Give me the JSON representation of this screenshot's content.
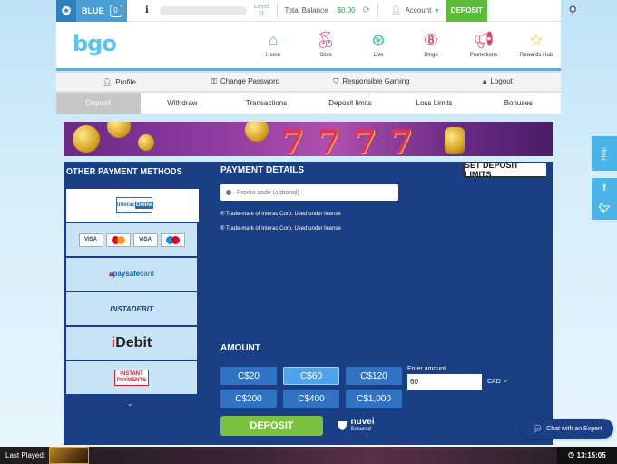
{
  "topbar": {
    "tier_label": "BLUE",
    "tier_count": "0",
    "level_label": "Level",
    "level_value": "0",
    "balance_label": "Total Balance",
    "balance_value": "$0.00",
    "account_label": "Account",
    "deposit_label": "DEPOSIT"
  },
  "header": {
    "logo": "bgo",
    "nav": [
      {
        "label": "Home",
        "icon": "home-icon"
      },
      {
        "label": "Slots",
        "icon": "cherries-icon"
      },
      {
        "label": "Live",
        "icon": "roulette-icon"
      },
      {
        "label": "Bingo",
        "icon": "bingo-ball-icon"
      },
      {
        "label": "Promotions",
        "icon": "megaphone-icon"
      },
      {
        "label": "Rewards Hub",
        "icon": "star-icon"
      }
    ]
  },
  "account_nav": [
    {
      "label": "Profile",
      "icon": "user-icon"
    },
    {
      "label": "Change Password",
      "icon": "key-icon"
    },
    {
      "label": "Responsible Gaming",
      "icon": "shield-icon"
    },
    {
      "label": "Logout",
      "icon": "lock-icon"
    }
  ],
  "tabs": [
    "Deposit",
    "Withdraw",
    "Transactions",
    "Deposit limits",
    "Loss Limits",
    "Bonuses"
  ],
  "deposit": {
    "other_methods_title": "OTHER PAYMENT METHODS",
    "methods": {
      "interac_a": "Interac",
      "interac_b": "Online",
      "visa": "VISA",
      "visa_debit": "VISA",
      "paysafe_a": "paysafe",
      "paysafe_b": "card",
      "instadebit": "INSTADEBIT",
      "idebit_a": "i",
      "idebit_b": "Debit",
      "instant_a": "INSTANT",
      "instant_b": "PAYMENTS"
    },
    "payment_details_title": "PAYMENT DETAILS",
    "set_limits_label": "SET DEPOSIT LIMITS",
    "promo_placeholder": "Promo code (optional)",
    "trademark_1": "® Trade-mark of Interac Corp. Used under license",
    "trademark_2": "® Trade-mark of Interac Corp. Used under license",
    "amount_title": "AMOUNT",
    "amounts": [
      "C$20",
      "C$60",
      "C$120",
      "C$200",
      "C$400",
      "C$1,000"
    ],
    "selected_amount": "C$60",
    "enter_amount_label": "Enter amount",
    "enter_amount_value": "60",
    "currency": "CAD",
    "deposit_button": "DEPOSIT",
    "nuvei_name": "nuvei",
    "nuvei_sub": "Secured"
  },
  "side": {
    "help": "Help",
    "facebook": "f",
    "twitter": "t"
  },
  "chat_label": "Chat with an Expert",
  "bottom": {
    "last_played": "Last Played:",
    "time": "13:15:05"
  },
  "colors": {
    "panel": "#1a3f84",
    "accent_green": "#5dbb3a",
    "accent_blue": "#4ab4e6"
  }
}
